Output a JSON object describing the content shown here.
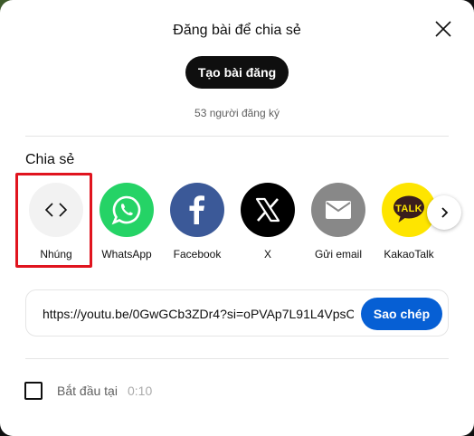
{
  "dialog": {
    "title": "Đăng bài để chia sẻ",
    "create_post_label": "Tạo bài đăng",
    "subscriber_count": "53 người đăng ký"
  },
  "share": {
    "section_title": "Chia sẻ",
    "items": [
      {
        "label": "Nhúng",
        "icon": "embed-code-icon",
        "color": "#f2f2f2"
      },
      {
        "label": "WhatsApp",
        "icon": "whatsapp-icon",
        "color": "#25d366"
      },
      {
        "label": "Facebook",
        "icon": "facebook-icon",
        "color": "#3b5998"
      },
      {
        "label": "X",
        "icon": "x-icon",
        "color": "#000000"
      },
      {
        "label": "Gửi email",
        "icon": "email-icon",
        "color": "#888888"
      },
      {
        "label": "KakaoTalk",
        "icon": "kakaotalk-icon",
        "color": "#fee500"
      }
    ],
    "kakaotalk_icon_text": "TALK"
  },
  "link": {
    "url": "https://youtu.be/0GwGCb3ZDr4?si=oPVAp7L91L4VpsC",
    "copy_label": "Sao chép"
  },
  "start_at": {
    "label": "Bắt đầu tại",
    "time": "0:10",
    "checked": false
  },
  "colors": {
    "primary_button": "#065fd4",
    "dark_button": "#0f0f0f",
    "highlight": "#e0141e"
  }
}
